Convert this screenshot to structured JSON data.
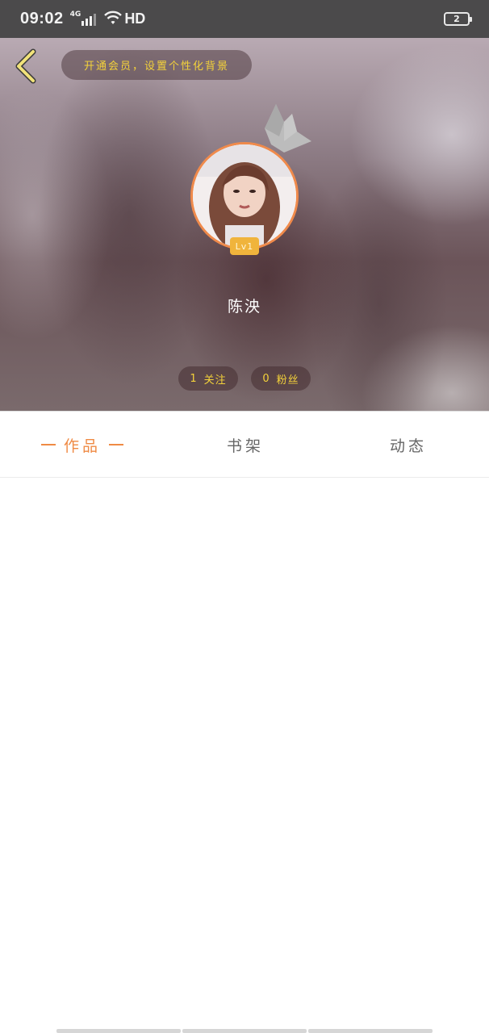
{
  "status_bar": {
    "time": "09:02",
    "network": "4G",
    "hd": "HD",
    "battery": "2"
  },
  "header": {
    "vip_banner": "开通会员，设置个性化背景",
    "level": "Lv1",
    "username": "陈泱",
    "follow_count": "1",
    "follow_label": "关注",
    "fans_count": "0",
    "fans_label": "粉丝"
  },
  "tabs": [
    {
      "label": "作品",
      "active": true
    },
    {
      "label": "书架",
      "active": false
    },
    {
      "label": "动态",
      "active": false
    }
  ],
  "colors": {
    "accent": "#ef8a44",
    "banner_text": "#f4d23a",
    "level_badge": "#f0b43c"
  }
}
